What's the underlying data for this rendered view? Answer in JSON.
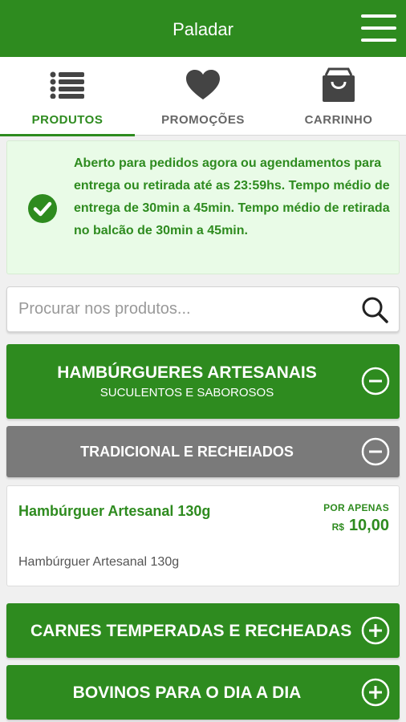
{
  "header": {
    "title": "Paladar",
    "menu_icon": "hamburger-menu-icon"
  },
  "tabs": [
    {
      "label": "PRODUTOS",
      "icon": "list-icon",
      "active": true
    },
    {
      "label": "PROMOÇÕES",
      "icon": "heart-icon",
      "active": false
    },
    {
      "label": "CARRINHO",
      "icon": "shopping-bag-icon",
      "active": false
    }
  ],
  "notice": {
    "text": "Aberto para pedidos agora ou agendamentos para entrega ou retirada até as 23:59hs. Tempo médio de entrega de 30min a 45min. Tempo médio de retirada no balcão de 30min a 45min.",
    "icon": "check-circle-icon"
  },
  "search": {
    "placeholder": "Procurar nos produtos...",
    "icon": "search-icon"
  },
  "categories": [
    {
      "title": "HAMBÚRGUERES ARTESANAIS",
      "subtitle": "SUCULENTOS E SABOROSOS",
      "expanded": true
    },
    {
      "title": "TRADICIONAL E RECHEIADOS",
      "expanded": true
    },
    {
      "title": "CARNES TEMPERADAS E RECHEADAS",
      "expanded": false
    },
    {
      "title": "BOVINOS PARA O DIA A DIA",
      "expanded": false
    }
  ],
  "product": {
    "name": "Hambúrguer Artesanal 130g",
    "price_label": "POR APENAS",
    "currency": "R$",
    "price": "10,00",
    "description": "Hambúrguer Artesanal 130g"
  },
  "colors": {
    "primary": "#2e8b1f",
    "subcategory": "#7a7a7a",
    "notice_bg": "#e9fbe7"
  }
}
